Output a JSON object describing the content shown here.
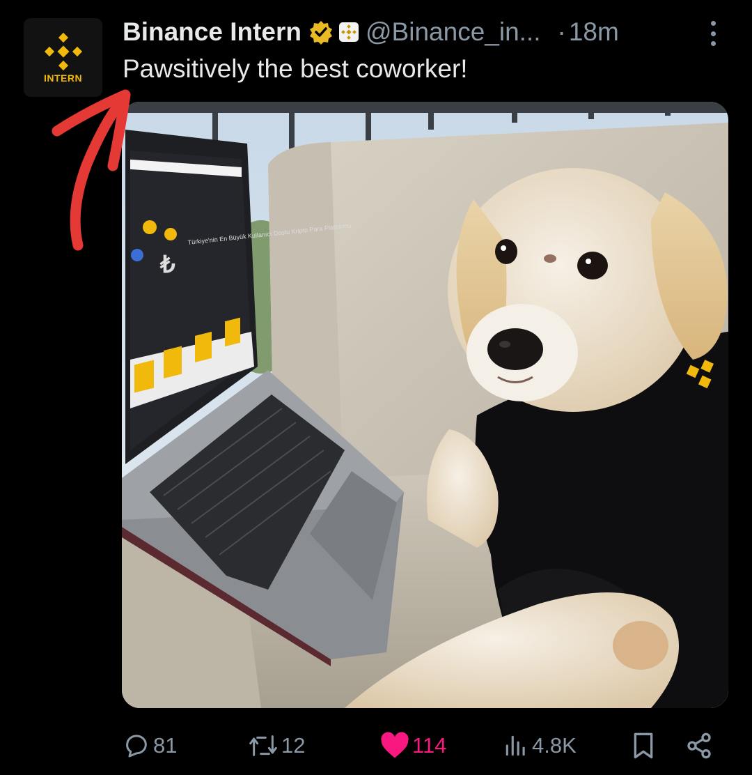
{
  "author": {
    "avatar_text": "INTERN",
    "name": "Binance Intern",
    "handle": "@Binance_in...",
    "separator": "·",
    "time": "18m"
  },
  "tweet": {
    "text": "Pawsitively the best coworker!"
  },
  "media": {
    "screen_headline": "Türkiye'nin En Büyük Kullanıcı Dostu Kripto Para Platformu",
    "shirt_logo_color": "#f0b90b"
  },
  "actions": {
    "replies": "81",
    "reposts": "12",
    "likes": "114",
    "views": "4.8K"
  },
  "colors": {
    "background": "#000000",
    "text": "#e7e9ea",
    "muted": "#8b98a5",
    "like": "#f91880",
    "brand": "#f0b90b",
    "annotation_arrow": "#e53935"
  },
  "icons": [
    "binance-logo-icon",
    "verified-badge-icon",
    "affiliate-badge-icon",
    "more-icon",
    "reply-icon",
    "repost-icon",
    "like-icon",
    "views-icon",
    "bookmark-icon",
    "share-icon"
  ]
}
